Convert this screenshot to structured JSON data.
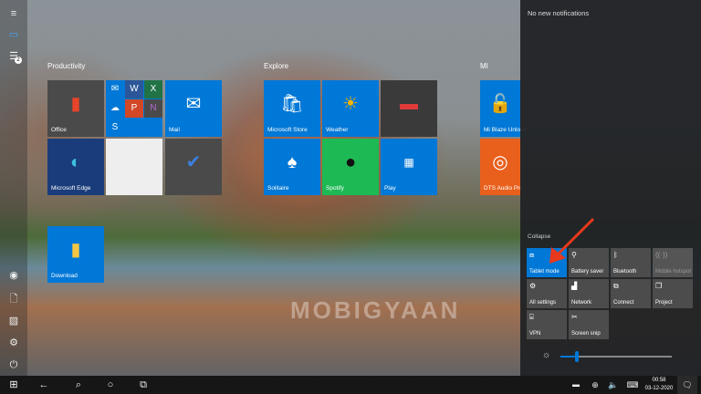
{
  "start": {
    "groups": [
      {
        "label": "Productivity"
      },
      {
        "label": "Explore"
      },
      {
        "label": "MI"
      }
    ],
    "tiles": {
      "office": "Office",
      "mail": "Mail",
      "edge": "Microsoft Edge",
      "download": "Download",
      "store": "Microsoft Store",
      "weather": "Weather",
      "solitaire": "Solitaire",
      "spotify": "Spotify",
      "play": "Play",
      "mi_blaze": "Mi Blaze Unlock",
      "dts": "DTS Audio Pro"
    },
    "list_badge": "2"
  },
  "action_center": {
    "notifications": "No new notifications",
    "collapse": "Collapse",
    "quick_actions": [
      {
        "label": "Tablet mode",
        "icon": "tablet-icon",
        "active": true
      },
      {
        "label": "Battery saver",
        "icon": "battery-saver-icon"
      },
      {
        "label": "Bluetooth",
        "icon": "bluetooth-icon"
      },
      {
        "label": "Mobile hotspot",
        "icon": "hotspot-icon",
        "disabled": true
      },
      {
        "label": "All settings",
        "icon": "gear-icon"
      },
      {
        "label": "Network",
        "icon": "network-icon"
      },
      {
        "label": "Connect",
        "icon": "connect-icon"
      },
      {
        "label": "Project",
        "icon": "project-icon"
      },
      {
        "label": "VPN",
        "icon": "vpn-icon"
      },
      {
        "label": "Screen snip",
        "icon": "screen-snip-icon"
      }
    ],
    "brightness_percent": 15
  },
  "taskbar": {
    "time": "00:58",
    "date": "03-12-2020"
  },
  "watermark": "MOBIGYAAN",
  "colors": {
    "accent": "#0078d7",
    "arrow": "#e8381d",
    "spotify": "#1db954"
  }
}
